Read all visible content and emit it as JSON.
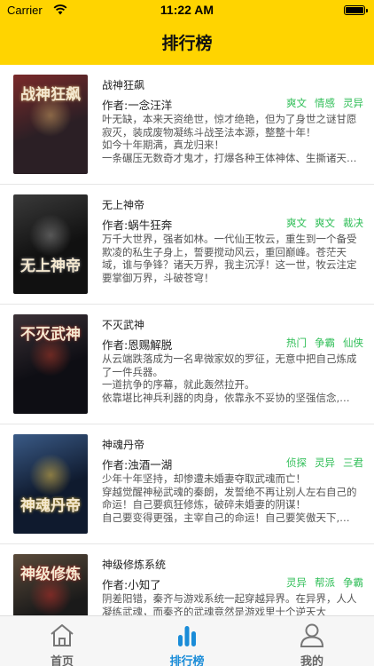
{
  "status_bar": {
    "carrier": "Carrier",
    "time": "11:22 AM"
  },
  "header": {
    "title": "排行榜"
  },
  "books": [
    {
      "title": "战神狂飙",
      "author": "作者:一念汪洋",
      "tags": [
        "爽文",
        "情感",
        "灵异"
      ],
      "desc": [
        "叶无缺，本来天资绝世，惊才绝艳，但为了身世之谜甘愿",
        "寂灭，装成废物凝练斗战圣法本源，整整十年！",
        "如今十年期满，真龙归来！",
        "一条碾压无数奇才鬼才，打爆各种王体神体、生撕诸天…"
      ],
      "cover_text": "战神狂飙",
      "cover_colors": [
        "#2b1f25",
        "#7a2a2a",
        "#c9a062"
      ]
    },
    {
      "title": "无上神帝",
      "author": "作者:蜗牛狂奔",
      "tags": [
        "爽文",
        "爽文",
        "裁决"
      ],
      "desc": [
        "万千大世界，强者如林。一代仙王牧云，重生到一个备受",
        "欺凌的私生子身上，誓要搅动风云，重回巅峰。苍茫天",
        "域，谁与争锋？诸天万界，我主沉浮！这一世，牧云注定",
        "要掌御万界，斗破苍穹！"
      ],
      "cover_text": "无上神帝",
      "cover_colors": [
        "#111111",
        "#3a3a3a",
        "#8a8a8a"
      ]
    },
    {
      "title": "不灭武神",
      "author": "作者:恩赐解脱",
      "tags": [
        "热门",
        "争霸",
        "仙侠"
      ],
      "desc": [
        "从云端跌落成为一名卑微家奴的罗征，无意中把自己炼成",
        "了一件兵器。",
        "一道抗争的序幕，就此轰然拉开。",
        "依靠堪比神兵利器的肉身，依靠永不妥协的坚强信念,…"
      ],
      "cover_text": "不灭武神",
      "cover_colors": [
        "#0e0e14",
        "#3b3136",
        "#b23a2a"
      ]
    },
    {
      "title": "神魂丹帝",
      "author": "作者:浊酒一湖",
      "tags": [
        "侦探",
        "灵异",
        "三君"
      ],
      "desc": [
        "少年十年坚持，却惨遭未婚妻夺取武魂而亡！",
        "穿越觉醒神秘武魂的秦朗，发誓绝不再让别人左右自己的",
        "命运！自己要疯狂修炼，破碎未婚妻的阴谋！",
        "自己要变得更强，主宰自己的命运！自己要笑傲天下,…"
      ],
      "cover_text": "神魂丹帝",
      "cover_colors": [
        "#0f1a2e",
        "#3a5a86",
        "#e8c046"
      ]
    },
    {
      "title": "神级修炼系统",
      "author": "作者:小知了",
      "tags": [
        "灵异",
        "帮派",
        "争霸"
      ],
      "desc": [
        "阴差阳错，秦齐与游戏系统一起穿越异界。在异界，人人",
        "凝练武魂，而秦齐的武魂竟然是游戏里十个逆天大"
      ],
      "cover_text": "神级修炼",
      "cover_colors": [
        "#1a1a1a",
        "#5a4a3a",
        "#c0302a"
      ]
    }
  ],
  "tabbar": {
    "tabs": [
      {
        "label": "首页",
        "icon": "home-icon"
      },
      {
        "label": "排行榜",
        "icon": "ranking-icon"
      },
      {
        "label": "我的",
        "icon": "profile-icon"
      }
    ],
    "active_color": "#1a8cd8",
    "inactive_color": "#666666"
  },
  "colors": {
    "header": "#ffd400",
    "tag": "#2fbe57"
  }
}
